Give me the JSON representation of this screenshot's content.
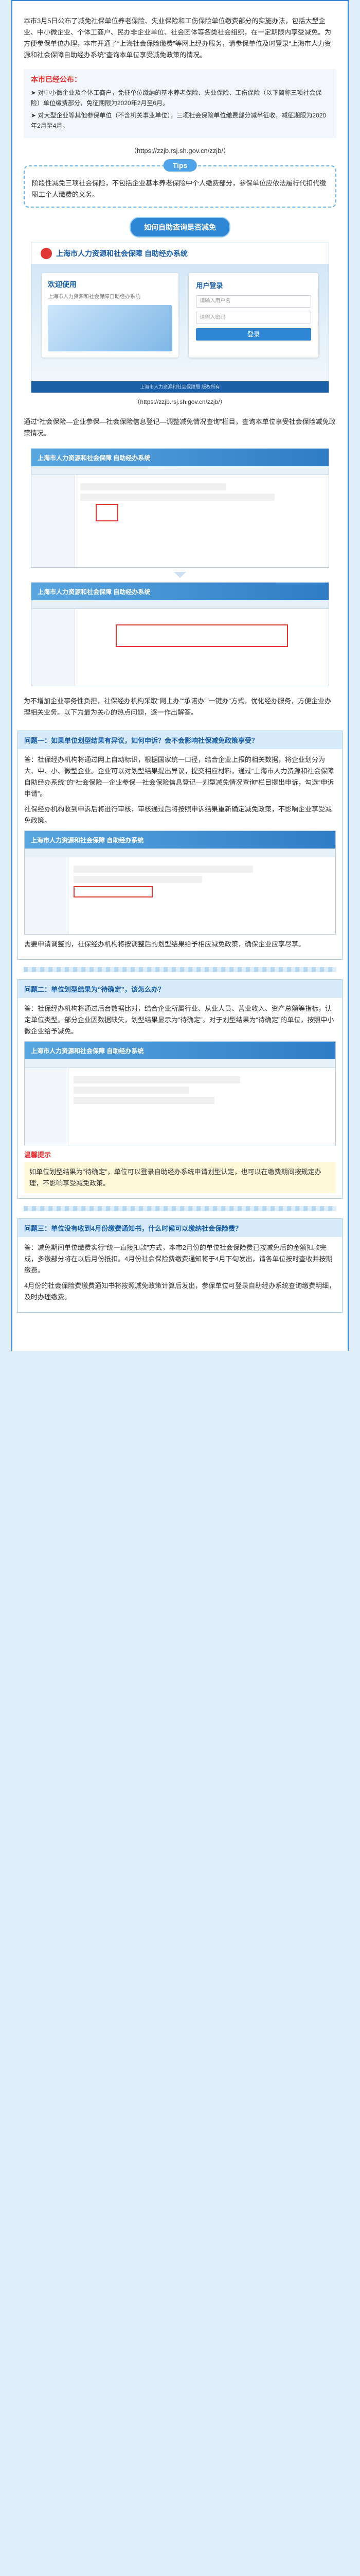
{
  "intro": {
    "text": "本市3月5日公布了减免社保单位养老保险、失业保险和工伤保险单位缴费部分的实施办法，包括大型企业、中小微企业、个体工商户、民办非企业单位、社会团体等各类社会组织，在一定期限内享受减免。为方便参保单位办理，本市开通了“上海社会保险缴费”等网上经办服务，请参保单位及时登录“上海市人力资源和社会保障自助经办系统”查询本单位享受减免政策的情况。"
  },
  "notice": {
    "title": "本市已经公布：",
    "items": [
      "➤ 对中小微企业及个体工商户，免征单位缴纳的基本养老保险、失业保险、工伤保险（以下简称三项社会保险）单位缴费部分，免征期限为2020年2月至6月。",
      "➤ 对大型企业等其他参保单位（不含机关事业单位），三项社会保险单位缴费部分减半征收，减征期限为2020年2月至4月。"
    ]
  },
  "url_line": "（https://zzjb.rsj.sh.gov.cn/zzjb/）",
  "tips": {
    "badge": "Tips",
    "text": "阶段性减免三项社会保险，不包括企业基本养老保险中个人缴费部分，参保单位应依法履行代扣代缴职工个人缴费的义务。"
  },
  "section1": {
    "title": "如何自助查询是否减免"
  },
  "login": {
    "system_name": "上海市人力资源和社会保障 自助经办系统",
    "welcome_title": "欢迎使用",
    "welcome_sub": "上海市人力资源和社会保障自助经办系统",
    "box_title": "用户登录",
    "field_user": "请输入用户名",
    "field_pass": "请输入密码",
    "button": "登录",
    "footer": "上海市人力资源和社会保障局 版权所有"
  },
  "login_caption": "（https://zzjb.rsj.sh.gov.cn/zzjb/）",
  "step_text": "通过“社会保险—企业参保—社会保险信息登记—调整减免情况查询”栏目，查询本单位享受社会保险减免政策情况。",
  "sys": {
    "header": "上海市人力资源和社会保障 自助经办系统"
  },
  "after_text": "为不增加企业事务性负担，社保经办机构采取“网上办”“承诺办”“一键办”方式，优化经办服务，方便企业办理相关业务。以下为最为关心的热点问题，逐一作出解答。",
  "q1": {
    "title": "问题一：如果单位划型结果有异议，如何申诉？会不会影响社保减免政策享受？",
    "answer": "答：社保经办机构将通过网上自动标识，根据国家统一口径，结合企业上报的相关数据，将企业划分为大、中、小、微型企业。企业可以对划型结果提出异议，提交相应材料，通过“上海市人力资源和社会保障自助经办系统”的“社会保险—企业参保—社会保险信息登记—划型减免情况查询”栏目提出申诉，勾选“申诉申请”。",
    "extra": "社保经办机构收到申诉后将进行审核，审核通过后将按照申诉结果重新确定减免政策，不影响企业享受减免政策。"
  },
  "q1_after": "需要申请调整的，社保经办机构将按调整后的划型结果给予相应减免政策，确保企业应享尽享。",
  "q2": {
    "title": "问题二：单位划型结果为“待确定”，该怎么办？",
    "answer": "答：社保经办机构将通过后台数据比对，结合企业所属行业、从业人员、营业收入、资产总额等指标，认定单位类型。部分企业因数据缺失，划型结果显示为“待确定”。对于划型结果为“待确定”的单位，按照中小微企业给予减免。",
    "warn_title": "温馨提示",
    "warn": "如单位划型结果为“待确定”，单位可以登录自助经办系统申请划型认定，也可以在缴费期间按规定办理，不影响享受减免政策。"
  },
  "q3": {
    "title": "问题三：单位没有收到4月份缴费通知书，什么时候可以缴纳社会保险费？",
    "answer": "答：减免期间单位缴费实行“统一直接扣款”方式，本市2月份的单位社会保险费已按减免后的金额扣款完成，多缴部分将在以后月份抵扣。4月份社会保险费缴费通知将于4月下旬发出，请各单位按时查收并按期缴费。",
    "extra": "4月份的社会保险费缴费通知书将按照减免政策计算后发出，参保单位可登录自助经办系统查询缴费明细，及时办理缴费。"
  }
}
